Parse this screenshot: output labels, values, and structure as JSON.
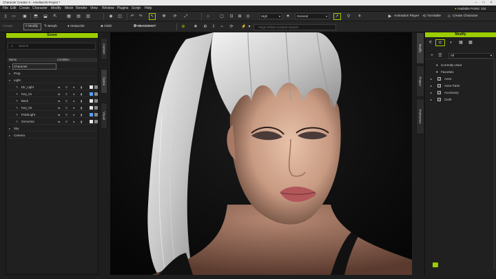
{
  "window": {
    "title": "Character Creator 4 - AmeliaUnit Project *",
    "controls": [
      "–",
      "□",
      "×"
    ]
  },
  "menu": [
    "File",
    "Edit",
    "Create",
    "Character",
    "Modify",
    "Mesh",
    "Render",
    "View",
    "Window",
    "Plugins",
    "Script",
    "Help"
  ],
  "toolbar": {
    "quality": "High",
    "shading": "General",
    "animation_player": "Animation Player",
    "turntable": "Turntable",
    "create_character": "Create Character",
    "available_points": "Available Points: 116"
  },
  "toolbar2": {
    "create": "Create",
    "modify": "Modify",
    "morph": "Morph",
    "install": "InstaLOD",
    "cloth": "Cloth",
    "headshot": "HEADSHOT",
    "smartsearch_placeholder": "Feign Online Content Search"
  },
  "scene": {
    "title": "Scene",
    "search_placeholder": "Search",
    "columns": [
      "Name",
      "Condition"
    ],
    "rows": [
      {
        "label": "Character",
        "level": 0,
        "selected": true
      },
      {
        "label": "Prop",
        "level": 0
      },
      {
        "label": "Light",
        "level": 0,
        "expanded": true
      },
      {
        "label": "Dir_Light",
        "level": 1,
        "light": true
      },
      {
        "label": "Key_01",
        "level": 1,
        "light": true
      },
      {
        "label": "Back",
        "level": 1,
        "light": true
      },
      {
        "label": "Key_02",
        "level": 1,
        "light": true
      },
      {
        "label": "PointLight",
        "level": 1,
        "light": true
      },
      {
        "label": "GIAnchor",
        "level": 1,
        "light": true
      },
      {
        "label": "Sky",
        "level": 0
      },
      {
        "label": "Camera",
        "level": 0
      }
    ]
  },
  "side_tabs": [
    "Content",
    "Scene",
    "Visual"
  ],
  "right_tabs": [
    "Modify",
    "Project",
    "Preference"
  ],
  "modify": {
    "title": "Modify",
    "filter": "All",
    "items": [
      {
        "label": "Currently Used",
        "kind": "dot"
      },
      {
        "label": "Favorites",
        "kind": "heart"
      },
      {
        "label": "Actor",
        "kind": "check"
      },
      {
        "label": "Actor Parts",
        "kind": "check"
      },
      {
        "label": "Accessory",
        "kind": "check"
      },
      {
        "label": "Cloth",
        "kind": "check"
      }
    ]
  },
  "colors": {
    "accent": "#9bcd00",
    "panel": "#202020",
    "viewport_bg": "#0d0d0d"
  }
}
